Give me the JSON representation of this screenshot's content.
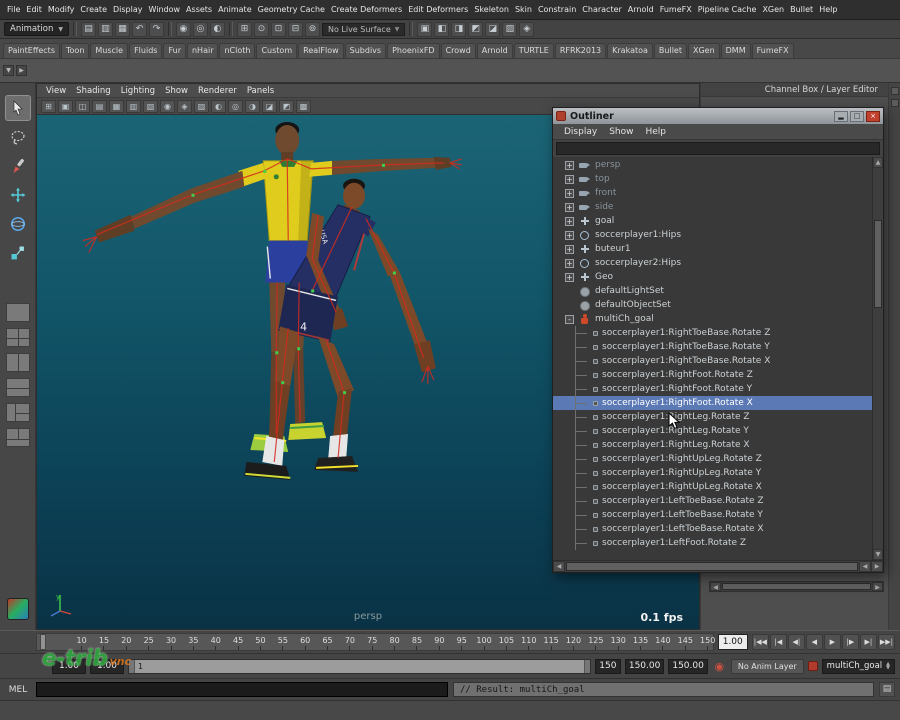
{
  "menubar": {
    "items": [
      "File",
      "Edit",
      "Modify",
      "Create",
      "Display",
      "Window",
      "Assets",
      "Animate",
      "Geometry Cache",
      "Create Deformers",
      "Edit Deformers",
      "Skeleton",
      "Skin",
      "Constrain",
      "Character",
      "Arnold",
      "FumeFX",
      "Pipeline Cache",
      "XGen",
      "Bullet",
      "Help"
    ]
  },
  "statusline": {
    "menu_set": "Animation",
    "group_a": [
      {
        "name": "new-scene-icon",
        "glyph": "▤"
      },
      {
        "name": "open-scene-icon",
        "glyph": "▥"
      },
      {
        "name": "save-scene-icon",
        "glyph": "▦"
      },
      {
        "name": "undo-icon",
        "glyph": "↶"
      },
      {
        "name": "redo-icon",
        "glyph": "↷"
      }
    ],
    "group_b": [
      {
        "name": "select-hierarchy-icon",
        "glyph": "◉"
      },
      {
        "name": "select-object-icon",
        "glyph": "◎"
      },
      {
        "name": "select-component-icon",
        "glyph": "◐"
      }
    ],
    "group_c": [
      {
        "name": "snap-to-grid-icon",
        "glyph": "⊞"
      },
      {
        "name": "snap-to-curve-icon",
        "glyph": "⊙"
      },
      {
        "name": "snap-to-point-icon",
        "glyph": "⊡"
      },
      {
        "name": "snap-to-plane-icon",
        "glyph": "⊟"
      },
      {
        "name": "make-live-icon",
        "glyph": "⊚"
      }
    ],
    "live_surface": "No Live Surface",
    "group_d": [
      {
        "name": "construction-history-icon",
        "glyph": "▣"
      },
      {
        "name": "render-frame-icon",
        "glyph": "◧"
      },
      {
        "name": "ipr-render-icon",
        "glyph": "◨"
      },
      {
        "name": "render-settings-icon",
        "glyph": "◩"
      },
      {
        "name": "paint-effects-icon",
        "glyph": "◪"
      },
      {
        "name": "hypershade-icon",
        "glyph": "▨"
      },
      {
        "name": "show-manipulators-icon",
        "glyph": "◈"
      }
    ]
  },
  "shelf": {
    "tabs": [
      "PaintEffects",
      "Toon",
      "Muscle",
      "Fluids",
      "Fur",
      "nHair",
      "nCloth",
      "Custom",
      "RealFlow",
      "Subdivs",
      "PhoenixFD",
      "Crowd",
      "Arnold",
      "TURTLE",
      "RFRK2013",
      "Krakatoa",
      "Bullet",
      "XGen",
      "DMM",
      "FumeFX"
    ]
  },
  "viewport": {
    "menus": [
      "View",
      "Shading",
      "Lighting",
      "Show",
      "Renderer",
      "Panels"
    ],
    "toolbar_icons": [
      {
        "name": "grid-icon",
        "glyph": "⊞"
      },
      {
        "name": "film-gate-icon",
        "glyph": "▣"
      },
      {
        "name": "resolution-gate-icon",
        "glyph": "◫"
      },
      {
        "name": "gate-mask-icon",
        "glyph": "▤"
      },
      {
        "name": "field-chart-icon",
        "glyph": "▦"
      },
      {
        "name": "safe-action-icon",
        "glyph": "▥"
      },
      {
        "name": "safe-title-icon",
        "glyph": "▧"
      },
      {
        "name": "camera-attributes-icon",
        "glyph": "◉"
      },
      {
        "name": "bookmarks-icon",
        "glyph": "◈"
      },
      {
        "name": "image-plane-icon",
        "glyph": "▨"
      },
      {
        "name": "two-d-pan-zoom-icon",
        "glyph": "◐"
      },
      {
        "name": "isolate-select-icon",
        "glyph": "◎"
      },
      {
        "name": "lighting-icon",
        "glyph": "◑"
      },
      {
        "name": "shadows-icon",
        "glyph": "◪"
      },
      {
        "name": "textured-icon",
        "glyph": "◩"
      },
      {
        "name": "wireframe-on-shaded-icon",
        "glyph": "▩"
      }
    ],
    "camera_label": "persp",
    "fps": "0.1 fps",
    "players": {
      "jersey_text": "USA",
      "jersey_number": "4"
    }
  },
  "right_panel": {
    "label": "Channel Box / Layer Editor"
  },
  "outliner": {
    "title": "Outliner",
    "window_buttons": [
      {
        "name": "minimize-button",
        "glyph": "▂"
      },
      {
        "name": "maximize-button",
        "glyph": "□"
      },
      {
        "name": "close-button",
        "glyph": "×",
        "close": true
      }
    ],
    "menus": [
      "Display",
      "Show",
      "Help"
    ],
    "items": [
      {
        "label": "persp",
        "icon": "camera",
        "expand": "+",
        "dim": true
      },
      {
        "label": "top",
        "icon": "camera",
        "expand": "+",
        "dim": true
      },
      {
        "label": "front",
        "icon": "camera",
        "expand": "+",
        "dim": true
      },
      {
        "label": "side",
        "icon": "camera",
        "expand": "+",
        "dim": true
      },
      {
        "label": "goal",
        "icon": "transform",
        "expand": "+"
      },
      {
        "label": "soccerplayer1:Hips",
        "icon": "joint",
        "expand": "+"
      },
      {
        "label": "buteur1",
        "icon": "transform",
        "expand": "+"
      },
      {
        "label": "soccerplayer2:Hips",
        "icon": "joint",
        "expand": "+"
      },
      {
        "label": "Geo",
        "icon": "transform",
        "expand": "+"
      },
      {
        "label": "defaultLightSet",
        "icon": "set"
      },
      {
        "label": "defaultObjectSet",
        "icon": "set"
      },
      {
        "label": "multiCh_goal",
        "icon": "character",
        "expand": "-"
      }
    ],
    "children": [
      {
        "label": "soccerplayer1:RightToeBase.Rotate Z"
      },
      {
        "label": "soccerplayer1:RightToeBase.Rotate Y"
      },
      {
        "label": "soccerplayer1:RightToeBase.Rotate X"
      },
      {
        "label": "soccerplayer1:RightFoot.Rotate Z"
      },
      {
        "label": "soccerplayer1:RightFoot.Rotate Y"
      },
      {
        "label": "soccerplayer1:RightFoot.Rotate X",
        "selected": true
      },
      {
        "label": "soccerplayer1:RightLeg.Rotate Z"
      },
      {
        "label": "soccerplayer1:RightLeg.Rotate Y"
      },
      {
        "label": "soccerplayer1:RightLeg.Rotate X"
      },
      {
        "label": "soccerplayer1:RightUpLeg.Rotate Z"
      },
      {
        "label": "soccerplayer1:RightUpLeg.Rotate Y"
      },
      {
        "label": "soccerplayer1:RightUpLeg.Rotate X"
      },
      {
        "label": "soccerplayer1:LeftToeBase.Rotate Z"
      },
      {
        "label": "soccerplayer1:LeftToeBase.Rotate Y"
      },
      {
        "label": "soccerplayer1:LeftToeBase.Rotate X"
      },
      {
        "label": "soccerplayer1:LeftFoot.Rotate Z"
      }
    ]
  },
  "timeline": {
    "ticks": [
      "10",
      "15",
      "20",
      "25",
      "30",
      "35",
      "40",
      "45",
      "50",
      "55",
      "60",
      "65",
      "70",
      "75",
      "80",
      "85",
      "90",
      "95",
      "100",
      "105",
      "110",
      "115",
      "120",
      "125",
      "130",
      "135",
      "140",
      "145",
      "150"
    ],
    "current_frame": "1.00"
  },
  "transport": {
    "buttons": [
      {
        "name": "go-to-start-button",
        "glyph": "|◀◀"
      },
      {
        "name": "step-back-key-button",
        "glyph": "|◀"
      },
      {
        "name": "step-back-frame-button",
        "glyph": "◀|"
      },
      {
        "name": "play-backwards-button",
        "glyph": "◀"
      },
      {
        "name": "play-forward-button",
        "glyph": "▶"
      },
      {
        "name": "step-forward-frame-button",
        "glyph": "|▶"
      },
      {
        "name": "step-forward-key-button",
        "glyph": "▶|"
      },
      {
        "name": "go-to-end-button",
        "glyph": "▶▶|"
      }
    ]
  },
  "range": {
    "anim_start": "1.00",
    "play_start": "1.00",
    "range_min": "1",
    "play_end": "150",
    "anim_end": "150.00",
    "anim_end_2": "150.00",
    "anim_layer": "No Anim Layer",
    "character_set": "multiCh_goal"
  },
  "mel": {
    "label": "MEL",
    "result": "// Result: multiCh_goal"
  },
  "watermark": {
    "text": "e-trib",
    "sub": "vnc"
  },
  "colors": {
    "selection": "#5b79b4",
    "viewport_top": "#1b6476",
    "viewport_bottom": "#0a3245",
    "character_icon": "#d04a2a"
  }
}
